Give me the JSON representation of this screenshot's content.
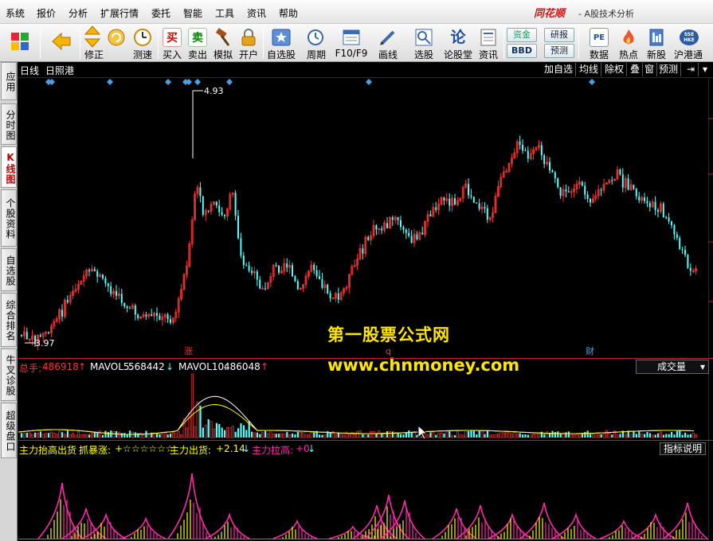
{
  "menu": [
    "系统",
    "报价",
    "分析",
    "扩展行情",
    "委托",
    "智能",
    "工具",
    "资讯",
    "帮助"
  ],
  "brand": {
    "logo": "同花顺",
    "subtitle": "- A股技术分析"
  },
  "toolbar": [
    {
      "label": "",
      "icon": "grid-icon"
    },
    {
      "label": "",
      "icon": "back-arrow-icon"
    },
    {
      "label": "修正",
      "icon": "up-down-arrows-icon"
    },
    {
      "label": "测速",
      "icon": "clock-icon"
    },
    {
      "label": "买入",
      "icon": "buy-icon",
      "glyph": "买"
    },
    {
      "label": "卖出",
      "icon": "sell-icon",
      "glyph": "卖"
    },
    {
      "label": "模拟",
      "icon": "hammer-icon"
    },
    {
      "label": "开户",
      "icon": "lock-icon"
    },
    {
      "label": "自选股",
      "icon": "star-icon"
    },
    {
      "label": "周期",
      "icon": "period-icon"
    },
    {
      "label": "F10/F9",
      "icon": "f10-icon"
    },
    {
      "label": "画线",
      "icon": "pen-icon"
    },
    {
      "label": "选股",
      "icon": "select-stock-icon"
    },
    {
      "label": "论股堂",
      "icon": "forum-icon",
      "glyph": "论"
    },
    {
      "label": "资讯",
      "icon": "news-icon"
    },
    {
      "label": "数据",
      "icon": "pe-icon",
      "glyph": "PE"
    },
    {
      "label": "热点",
      "icon": "hot-icon"
    },
    {
      "label": "新股",
      "icon": "new-stock-icon"
    },
    {
      "label": "沪港通",
      "icon": "hk-connect-icon"
    }
  ],
  "toolbar_small": [
    "资金",
    "BBD",
    "研报",
    "预测"
  ],
  "side_tabs": [
    "应用",
    "分时图",
    "K线图",
    "个股资料",
    "自选股",
    "综合排名",
    "牛叉诊股",
    "超级盘口"
  ],
  "chart": {
    "period": "日线",
    "stock": "日照港",
    "right_buttons": [
      "加自选",
      "均线",
      "除权",
      "叠",
      "窗",
      "预测"
    ],
    "high_label": "4.93",
    "low_label": "3.97",
    "markers": [
      "涨",
      "q",
      "财"
    ]
  },
  "volume": {
    "total_label": "总手:",
    "total_value": "486918",
    "mavol5_label": "MAVOL5:",
    "mavol5_value": "568442",
    "mavol10_label": "MAVOL10:",
    "mavol10_value": "486048",
    "selector": "成交量"
  },
  "indicator": {
    "title": "主力抬高出货",
    "zhua_label": "抓暴涨:",
    "zhua_value": "+☆☆☆☆☆☆",
    "chu_label": "主力出货:",
    "chu_value": "+2.14",
    "la_label": "主力拉高:",
    "la_value": "+0",
    "explain": "指标说明"
  },
  "watermark": {
    "line1": "第一股票公式网",
    "line2": "www.chnmoney.com"
  },
  "colors": {
    "up": "#ff3232",
    "down": "#54ffff",
    "ma5": "#ffffff",
    "ma10": "#ffff00",
    "magenta": "#ff2aa8",
    "yellow": "#ffff00"
  }
}
